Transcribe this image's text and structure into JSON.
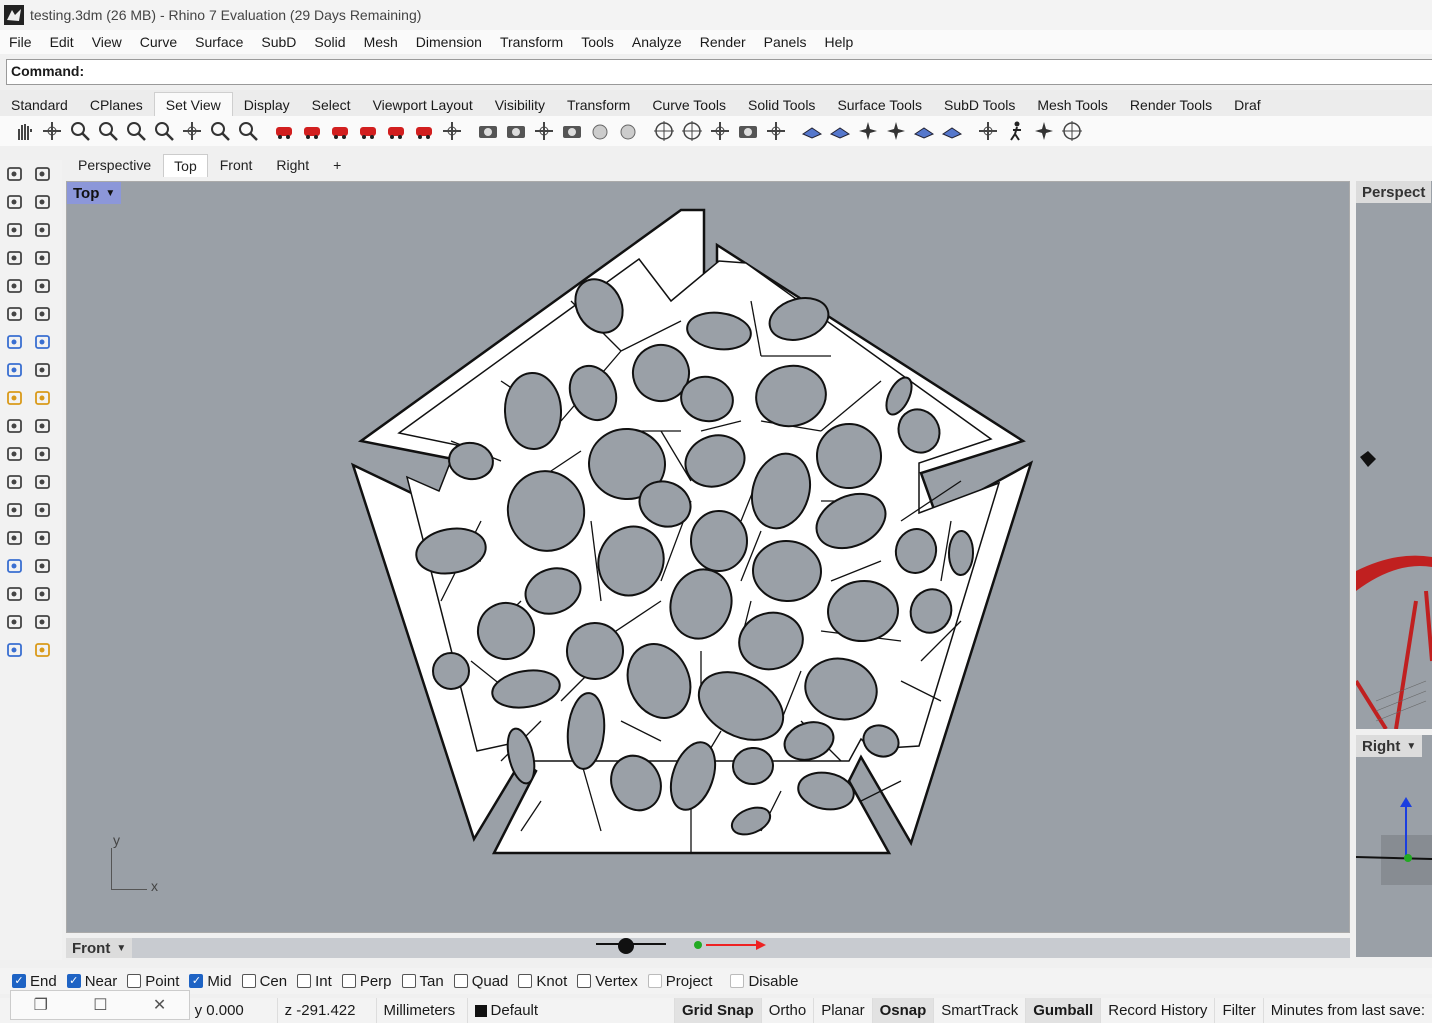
{
  "window": {
    "title": "testing.3dm (26 MB) - Rhino 7 Evaluation (29 Days Remaining)"
  },
  "menu": [
    "File",
    "Edit",
    "View",
    "Curve",
    "Surface",
    "SubD",
    "Solid",
    "Mesh",
    "Dimension",
    "Transform",
    "Tools",
    "Analyze",
    "Render",
    "Panels",
    "Help"
  ],
  "command": {
    "label": "Command:"
  },
  "toolbar_tabs": [
    "Standard",
    "CPlanes",
    "Set View",
    "Display",
    "Select",
    "Viewport Layout",
    "Visibility",
    "Transform",
    "Curve Tools",
    "Solid Tools",
    "Surface Tools",
    "SubD Tools",
    "Mesh Tools",
    "Render Tools",
    "Draf"
  ],
  "active_toolbar_tab": "Set View",
  "viewport_tabs": [
    "Perspective",
    "Top",
    "Front",
    "Right",
    "+"
  ],
  "active_viewport_tab": "Top",
  "viewports": {
    "main": "Top",
    "perspective": "Perspect",
    "right": "Right",
    "front": "Front"
  },
  "axis": {
    "x": "x",
    "y": "y"
  },
  "osnaps": [
    {
      "label": "End",
      "checked": true
    },
    {
      "label": "Near",
      "checked": true
    },
    {
      "label": "Point",
      "checked": false
    },
    {
      "label": "Mid",
      "checked": true
    },
    {
      "label": "Cen",
      "checked": false
    },
    {
      "label": "Int",
      "checked": false
    },
    {
      "label": "Perp",
      "checked": false
    },
    {
      "label": "Tan",
      "checked": false
    },
    {
      "label": "Quad",
      "checked": false
    },
    {
      "label": "Knot",
      "checked": false
    },
    {
      "label": "Vertex",
      "checked": false
    },
    {
      "label": "Project",
      "checked": false
    },
    {
      "label": "Disable",
      "checked": false
    }
  ],
  "status": {
    "y": "y 0.000",
    "z": "z -291.422",
    "units": "Millimeters",
    "layer": "Default",
    "toggles": [
      "Grid Snap",
      "Ortho",
      "Planar",
      "Osnap",
      "SmartTrack",
      "Gumball",
      "Record History",
      "Filter",
      "Minutes from last save:"
    ],
    "bold_toggles": [
      "Grid Snap",
      "Osnap",
      "Gumball"
    ]
  },
  "window_controls": {
    "restore": "❐",
    "maximize": "☐",
    "close": "✕"
  },
  "colors": {
    "viewport_bg": "#9aa0a7",
    "active_label": "#8c97d9",
    "accent": "#1e63c4"
  }
}
